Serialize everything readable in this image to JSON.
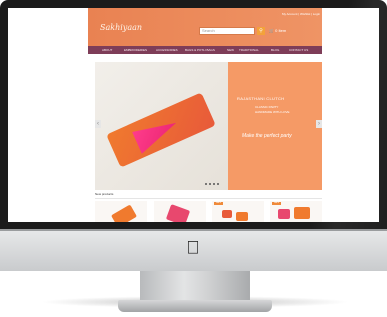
{
  "site": {
    "logo": "Sakhiyaan",
    "top_links": "My Account | Wishlist | Login",
    "search_placeholder": "Search",
    "cart": "0 Item"
  },
  "nav": {
    "items": [
      {
        "label": "ABOUT",
        "key": "about"
      },
      {
        "label": "EMBROIDERIES",
        "key": "embroideries"
      },
      {
        "label": "ACCESSORIES",
        "key": "accessories"
      },
      {
        "label": "BAGS & POTLI BAGS",
        "key": "bags"
      },
      {
        "label": "NEW",
        "key": "new"
      },
      {
        "label": "TRADITIONAL",
        "key": "traditional"
      },
      {
        "label": "BLOG",
        "key": "blog"
      },
      {
        "label": "CONTACT US",
        "key": "contact"
      }
    ]
  },
  "slider": {
    "line1": "RAJASTHANI CLUTCH",
    "line2": "CLASSIC PARTY",
    "line3": "HANDMADE WITH LOVE",
    "tagline": "Make the perfect party",
    "dots_count": 4
  },
  "products": {
    "section_title": "New products",
    "badge": "SALE"
  },
  "colors": {
    "header": "#e98252",
    "nav": "#7e3d58",
    "accent": "#f3a23a",
    "panel": "#f59a66"
  }
}
